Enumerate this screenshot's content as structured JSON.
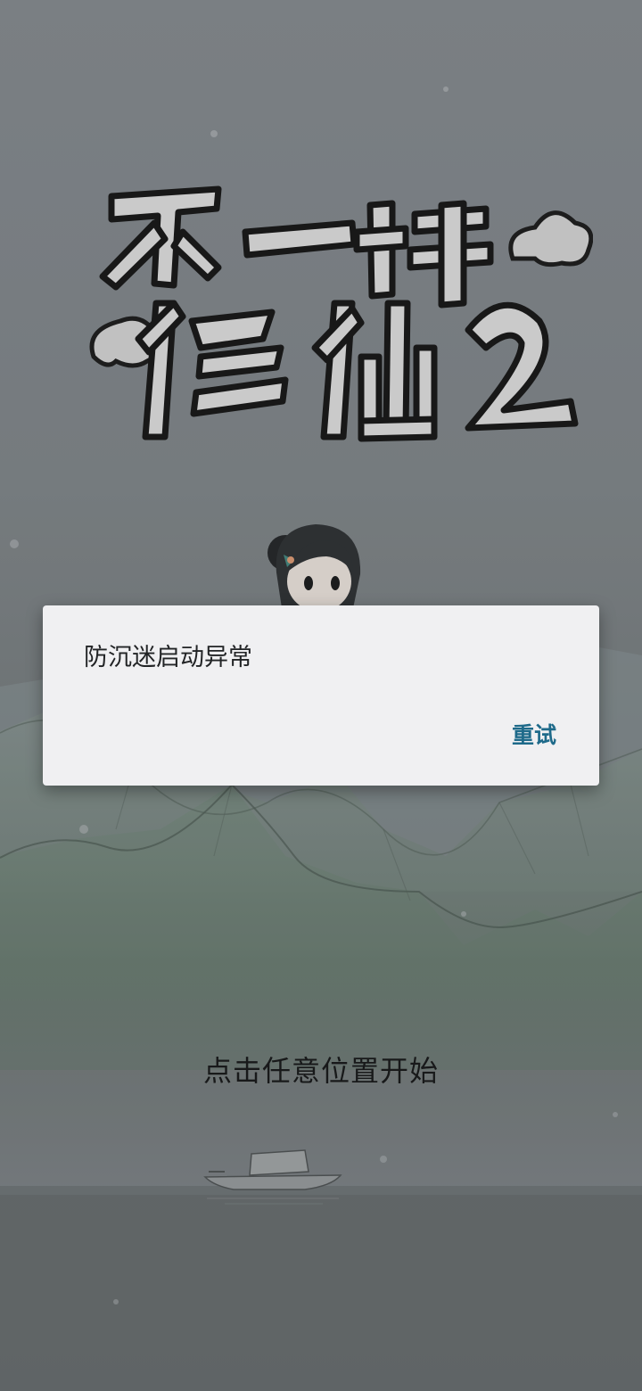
{
  "game": {
    "title_logo_text": "不一样修仙2",
    "start_hint": "点击任意位置开始"
  },
  "dialog": {
    "message": "防沉迷启动异常",
    "retry_label": "重试"
  },
  "colors": {
    "accent": "#1e6a8a",
    "dialog_background": "#f0f0f2",
    "background": "#868c90"
  }
}
